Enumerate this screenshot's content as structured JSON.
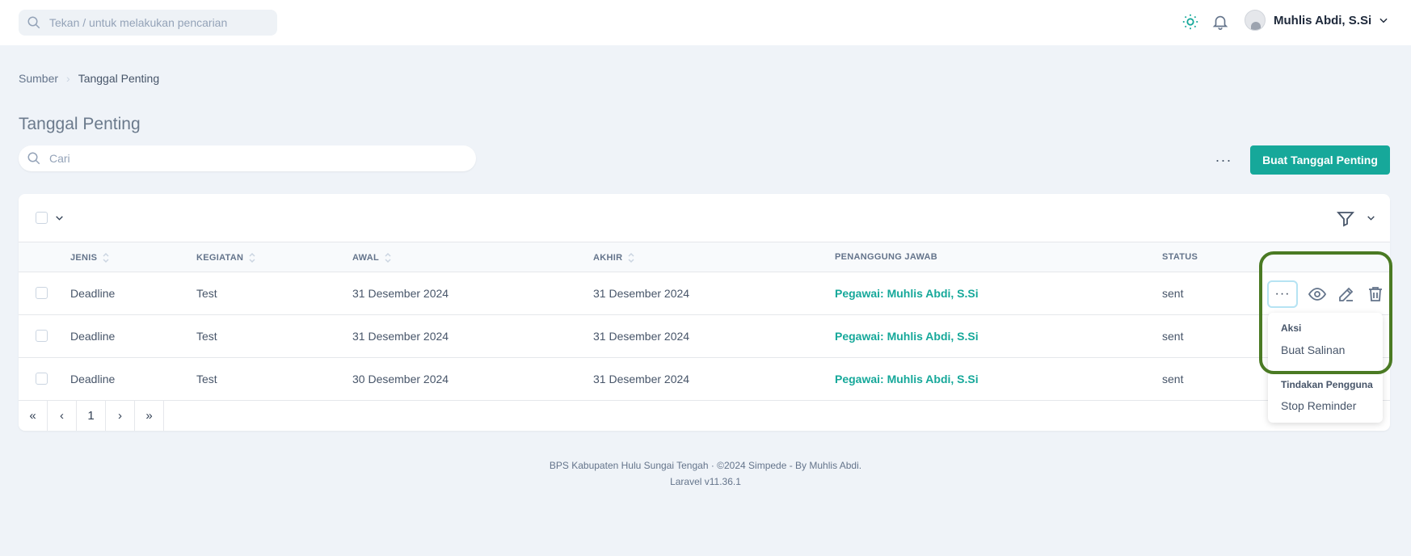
{
  "header": {
    "search_placeholder": "Tekan / untuk melakukan pencarian",
    "user_name": "Muhlis Abdi, S.Si",
    "accent_color": "#16a89a"
  },
  "breadcrumb": {
    "items": [
      "Sumber",
      "Tanggal Penting"
    ]
  },
  "page": {
    "title": "Tanggal Penting",
    "search_placeholder": "Cari",
    "more_label": "···",
    "create_label": "Buat Tanggal Penting"
  },
  "table": {
    "columns": [
      "JENIS",
      "KEGIATAN",
      "AWAL",
      "AKHIR",
      "PENANGGUNG JAWAB",
      "STATUS"
    ],
    "rows": [
      {
        "jenis": "Deadline",
        "kegiatan": "Test",
        "awal": "31 Desember 2024",
        "akhir": "31 Desember 2024",
        "penanggung_jawab": "Pegawai: Muhlis Abdi, S.Si",
        "status": "sent"
      },
      {
        "jenis": "Deadline",
        "kegiatan": "Test",
        "awal": "31 Desember 2024",
        "akhir": "31 Desember 2024",
        "penanggung_jawab": "Pegawai: Muhlis Abdi, S.Si",
        "status": "sent"
      },
      {
        "jenis": "Deadline",
        "kegiatan": "Test",
        "awal": "30 Desember 2024",
        "akhir": "31 Desember 2024",
        "penanggung_jawab": "Pegawai: Muhlis Abdi, S.Si",
        "status": "sent"
      }
    ],
    "row_menu_label": "···"
  },
  "pagination": {
    "first": "«",
    "prev": "‹",
    "current": "1",
    "next": "›",
    "last": "»"
  },
  "dropdown": {
    "section1_heading": "Aksi",
    "section1_item": "Buat Salinan",
    "section2_heading": "Tindakan Pengguna",
    "section2_item": "Stop Reminder"
  },
  "footer": {
    "line1": "BPS Kabupaten Hulu Sungai Tengah  ·  ©2024 Simpede - By Muhlis Abdi.",
    "line2": "Laravel v11.36.1"
  }
}
